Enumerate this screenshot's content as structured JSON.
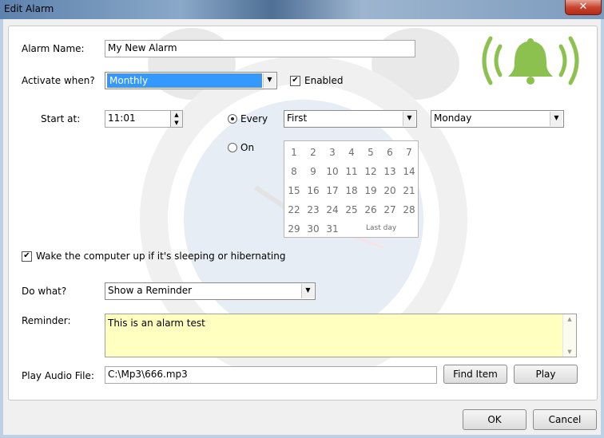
{
  "window": {
    "title": "Edit Alarm",
    "close_glyph": "✕"
  },
  "form": {
    "alarm_name_label": "Alarm Name:",
    "alarm_name_value": "My New Alarm",
    "activate_label": "Activate when?",
    "activate_value": "Monthly",
    "enabled_label": "Enabled",
    "enabled_checked": true,
    "start_label": "Start at:",
    "start_value": "11:01",
    "every_label": "Every",
    "every_selected": true,
    "on_label": "On",
    "on_selected": false,
    "ordinal_value": "First",
    "weekday_value": "Monday",
    "calendar_days": [
      "1",
      "2",
      "3",
      "4",
      "5",
      "6",
      "7",
      "8",
      "9",
      "10",
      "11",
      "12",
      "13",
      "14",
      "15",
      "16",
      "17",
      "18",
      "19",
      "20",
      "21",
      "22",
      "23",
      "24",
      "25",
      "26",
      "27",
      "28",
      "29",
      "30",
      "31"
    ],
    "calendar_last_day": "Last day",
    "wake_label": "Wake the computer up if it's sleeping or hibernating",
    "wake_checked": true,
    "do_what_label": "Do what?",
    "do_what_value": "Show a Reminder",
    "reminder_label": "Reminder:",
    "reminder_value": "This is an alarm test",
    "audio_label": "Play Audio File:",
    "audio_value": "C:\\Mp3\\666.mp3",
    "find_item_button": "Find Item",
    "play_button": "Play"
  },
  "footer": {
    "ok_button": "OK",
    "cancel_button": "Cancel"
  },
  "icons": {
    "bell": "bell-ringing-icon",
    "accent_color": "#8cc04f"
  }
}
